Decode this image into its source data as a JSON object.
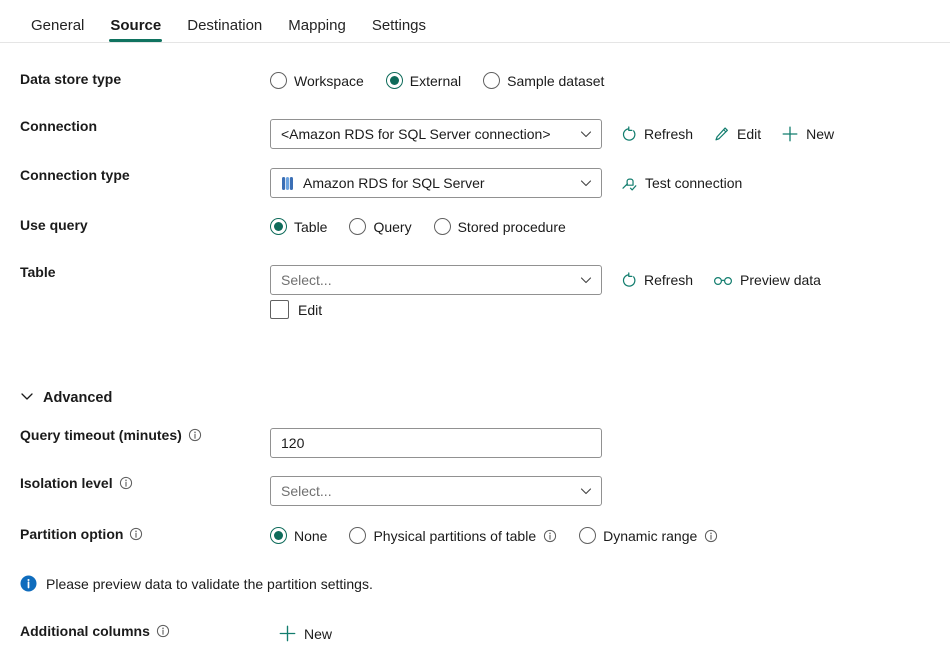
{
  "tabs": [
    {
      "label": "General",
      "active": false
    },
    {
      "label": "Source",
      "active": true
    },
    {
      "label": "Destination",
      "active": false
    },
    {
      "label": "Mapping",
      "active": false
    },
    {
      "label": "Settings",
      "active": false
    }
  ],
  "accent_color": "#107360",
  "info_color": "#0f6cbd",
  "form": {
    "data_store_type": {
      "label": "Data store type",
      "options": [
        "Workspace",
        "External",
        "Sample dataset"
      ],
      "selected": "External"
    },
    "connection": {
      "label": "Connection",
      "value": "<Amazon RDS for SQL Server connection>",
      "actions": [
        {
          "label": "Refresh",
          "icon": "refresh-icon"
        },
        {
          "label": "Edit",
          "icon": "pencil-icon"
        },
        {
          "label": "New",
          "icon": "plus-icon"
        }
      ]
    },
    "connection_type": {
      "label": "Connection type",
      "value": "Amazon RDS for SQL Server",
      "icon": "database-icon",
      "actions": [
        {
          "label": "Test connection",
          "icon": "plug-check-icon"
        }
      ]
    },
    "use_query": {
      "label": "Use query",
      "options": [
        "Table",
        "Query",
        "Stored procedure"
      ],
      "selected": "Table"
    },
    "table": {
      "label": "Table",
      "placeholder": "Select...",
      "value": "",
      "actions": [
        {
          "label": "Refresh",
          "icon": "refresh-icon"
        },
        {
          "label": "Preview data",
          "icon": "glasses-icon"
        }
      ],
      "edit_checkbox_label": "Edit",
      "edit_checkbox_checked": false
    },
    "advanced": {
      "label": "Advanced",
      "expanded": true
    },
    "query_timeout": {
      "label": "Query timeout (minutes)",
      "value": "120",
      "has_info": true
    },
    "isolation_level": {
      "label": "Isolation level",
      "placeholder": "Select...",
      "value": "",
      "has_info": true
    },
    "partition_option": {
      "label": "Partition option",
      "has_info": true,
      "options": [
        {
          "label": "None",
          "has_info": false
        },
        {
          "label": "Physical partitions of table",
          "has_info": true
        },
        {
          "label": "Dynamic range",
          "has_info": true
        }
      ],
      "selected": "None"
    },
    "partition_message": "Please preview data to validate the partition settings.",
    "additional_columns": {
      "label": "Additional columns",
      "has_info": true,
      "actions": [
        {
          "label": "New",
          "icon": "plus-icon"
        }
      ]
    }
  }
}
